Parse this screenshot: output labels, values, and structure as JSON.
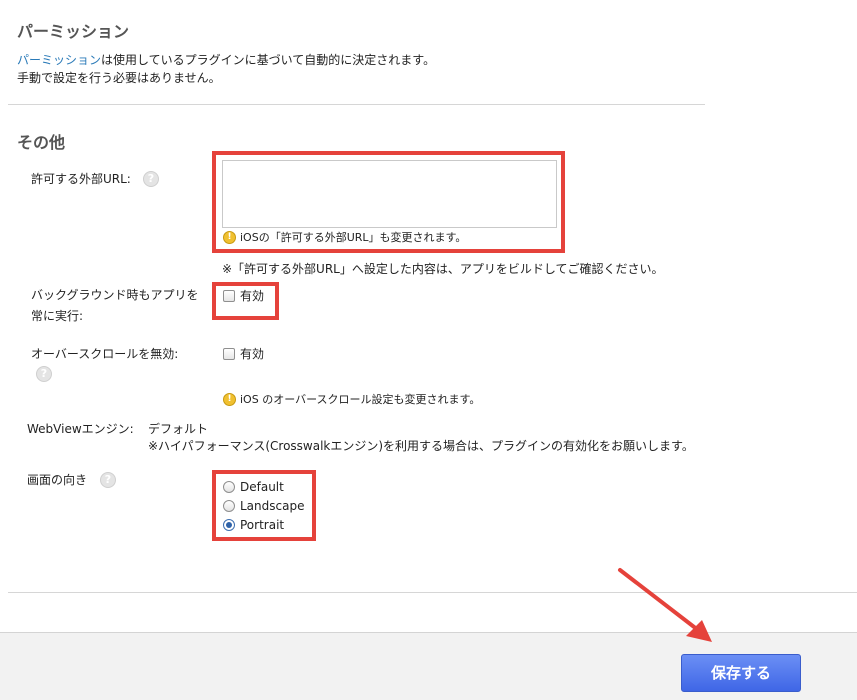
{
  "permissions": {
    "title": "パーミッション",
    "desc_link": "パーミッション",
    "desc_rest": "は使用しているプラグインに基づいて自動的に決定されます。",
    "desc_line2": "手動で設定を行う必要はありません。"
  },
  "other": {
    "title": "その他",
    "external_url": {
      "label": "許可する外部URL:",
      "help_glyph": "?",
      "value": "",
      "ios_note": "iOSの「許可する外部URL」も変更されます。",
      "build_note": "※「許可する外部URL」へ設定した内容は、アプリをビルドしてご確認ください。"
    },
    "background_run": {
      "label_line1": "バックグラウンド時もアプリを",
      "label_line2": "常に実行:",
      "checkbox_label": "有効"
    },
    "disable_overscroll": {
      "label": "オーバースクロールを無効:",
      "help_glyph": "?",
      "checkbox_label": "有効",
      "ios_note": "iOS のオーバースクロール設定も変更されます。"
    },
    "webview_engine": {
      "label": "WebViewエンジン:",
      "value": "デフォルト",
      "note": "※ハイパフォーマンス(Crosswalkエンジン)を利用する場合は、プラグインの有効化をお願いします。"
    },
    "orientation": {
      "label": "画面の向き",
      "help_glyph": "?",
      "options": [
        "Default",
        "Landscape",
        "Portrait"
      ],
      "selected": "Portrait"
    }
  },
  "footer": {
    "save_label": "保存する"
  },
  "colors": {
    "highlight": "#e5423b",
    "link": "#2a7ab8",
    "save_button": "#4a6fe9"
  }
}
